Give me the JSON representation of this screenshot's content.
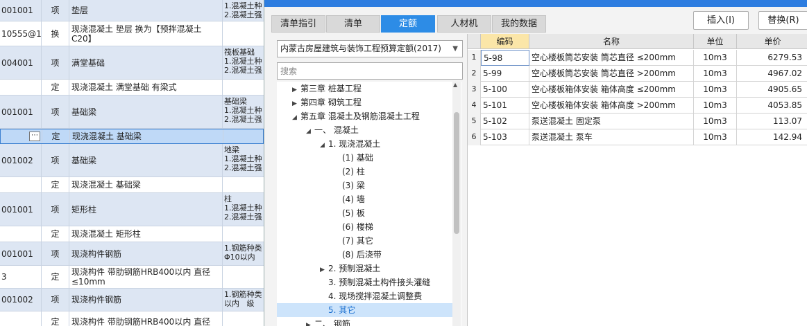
{
  "left_table": {
    "rows": [
      {
        "code": "001001",
        "type": "项",
        "name": "垫层",
        "features": "1.混凝土种\n2.混凝土强",
        "kind": "xiang",
        "h": 31
      },
      {
        "code": "10555@1…",
        "type": "换",
        "name": "现浇混凝土 垫层  换为【预拌混凝土C20】",
        "features": "",
        "kind": "ding",
        "h": 36
      },
      {
        "code": "004001",
        "type": "项",
        "name": "满堂基础",
        "features": "筏板基础\n1.混凝土种\n2.混凝土强",
        "kind": "xiang",
        "h": 48
      },
      {
        "code": "",
        "type": "定",
        "name": "现浇混凝土 满堂基础 有梁式",
        "features": "",
        "kind": "ding",
        "h": 23
      },
      {
        "code": "001001",
        "type": "项",
        "name": "基础梁",
        "features": "基础梁\n1.混凝土种\n2.混凝土强",
        "kind": "xiang",
        "h": 48
      },
      {
        "code": "",
        "type": "定",
        "name": "现浇混凝土 基础梁",
        "features": "",
        "kind": "selected",
        "h": 22,
        "dots": "⋯"
      },
      {
        "code": "001002",
        "type": "项",
        "name": "基础梁",
        "features": "地梁\n1.混凝土种\n2.混凝土强",
        "kind": "xiang",
        "h": 48
      },
      {
        "code": "",
        "type": "定",
        "name": "现浇混凝土 基础梁",
        "features": "",
        "kind": "ding",
        "h": 23
      },
      {
        "code": "001001",
        "type": "项",
        "name": "矩形柱",
        "features": "柱\n1.混凝土种\n2.混凝土强",
        "kind": "xiang",
        "h": 48
      },
      {
        "code": "",
        "type": "定",
        "name": "现浇混凝土 矩形柱",
        "features": "",
        "kind": "ding",
        "h": 23
      },
      {
        "code": "001001",
        "type": "项",
        "name": "现浇构件钢筋",
        "features": "1.钢筋种类\nΦ10以内",
        "kind": "xiang",
        "h": 34
      },
      {
        "code": "3",
        "type": "定",
        "name": "现浇构件 带肋钢筋HRB400以内 直径≤10mm",
        "features": "",
        "kind": "ding",
        "h": 33
      },
      {
        "code": "001002",
        "type": "项",
        "name": "现浇构件钢筋",
        "features": "1.钢筋种类\n以内   级",
        "kind": "xiang",
        "h": 33
      },
      {
        "code": "",
        "type": "定",
        "name": "现浇构件 带肋钢筋HRB400以内 直径",
        "features": "",
        "kind": "ding",
        "h": 30
      }
    ]
  },
  "dialog": {
    "tabs": [
      "清单指引",
      "清单",
      "定额",
      "人材机",
      "我的数据"
    ],
    "active_tab_index": 2,
    "buttons": {
      "insert": "插入(I)",
      "replace": "替换(R)"
    },
    "library": "内蒙古房屋建筑与装饰工程预算定额(2017)",
    "search_placeholder": "搜索",
    "tree": [
      {
        "label": "第三章 桩基工程",
        "indent": 0,
        "toggle": "▶"
      },
      {
        "label": "第四章 砌筑工程",
        "indent": 0,
        "toggle": "▶"
      },
      {
        "label": "第五章 混凝土及钢筋混凝土工程",
        "indent": 0,
        "toggle": "◢"
      },
      {
        "label": "一、 混凝土",
        "indent": 1,
        "toggle": "◢"
      },
      {
        "label": "1. 现浇混凝土",
        "indent": 2,
        "toggle": "◢"
      },
      {
        "label": "(1) 基础",
        "indent": 3,
        "toggle": ""
      },
      {
        "label": "(2) 柱",
        "indent": 3,
        "toggle": ""
      },
      {
        "label": "(3) 梁",
        "indent": 3,
        "toggle": ""
      },
      {
        "label": "(4) 墙",
        "indent": 3,
        "toggle": ""
      },
      {
        "label": "(5) 板",
        "indent": 3,
        "toggle": ""
      },
      {
        "label": "(6) 楼梯",
        "indent": 3,
        "toggle": ""
      },
      {
        "label": "(7) 其它",
        "indent": 3,
        "toggle": ""
      },
      {
        "label": "(8) 后浇带",
        "indent": 3,
        "toggle": ""
      },
      {
        "label": "2. 预制混凝土",
        "indent": 2,
        "toggle": "▶"
      },
      {
        "label": "3. 预制混凝土构件接头灌缝",
        "indent": 2,
        "toggle": ""
      },
      {
        "label": "4. 现场搅拌混凝土调整费",
        "indent": 2,
        "toggle": ""
      },
      {
        "label": "5. 其它",
        "indent": 2,
        "toggle": "",
        "selected": true
      },
      {
        "label": "二、 钢筋",
        "indent": 1,
        "toggle": "▶"
      }
    ],
    "grid": {
      "headers": [
        "编码",
        "名称",
        "单位",
        "单价"
      ],
      "rows": [
        {
          "no": "1",
          "code": "5-98",
          "name": "空心楼板筒芯安装 筒芯直径 ≤200mm",
          "unit": "10m3",
          "price": "6279.53"
        },
        {
          "no": "2",
          "code": "5-99",
          "name": "空心楼板筒芯安装 筒芯直径 >200mm",
          "unit": "10m3",
          "price": "4967.02"
        },
        {
          "no": "3",
          "code": "5-100",
          "name": "空心楼板箱体安装 箱体高度 ≤200mm",
          "unit": "10m3",
          "price": "4905.65"
        },
        {
          "no": "4",
          "code": "5-101",
          "name": "空心楼板箱体安装 箱体高度 >200mm",
          "unit": "10m3",
          "price": "4053.85"
        },
        {
          "no": "5",
          "code": "5-102",
          "name": "泵送混凝土 固定泵",
          "unit": "10m3",
          "price": "113.07"
        },
        {
          "no": "6",
          "code": "5-103",
          "name": "泵送混凝土 泵车",
          "unit": "10m3",
          "price": "142.94"
        }
      ]
    }
  }
}
